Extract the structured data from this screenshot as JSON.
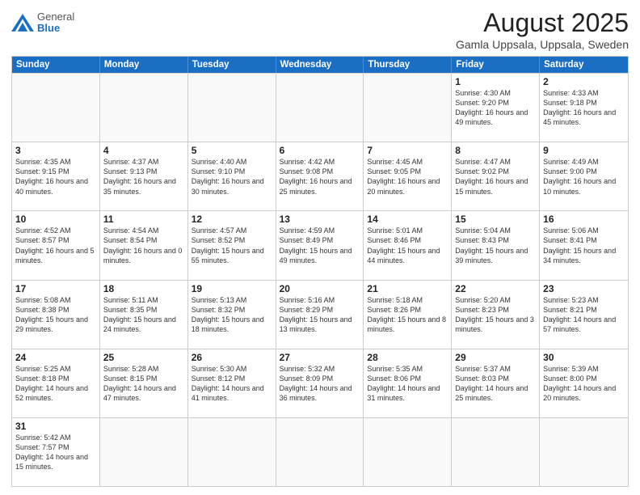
{
  "header": {
    "logo_general": "General",
    "logo_blue": "Blue",
    "title": "August 2025",
    "subtitle": "Gamla Uppsala, Uppsala, Sweden"
  },
  "weekdays": [
    "Sunday",
    "Monday",
    "Tuesday",
    "Wednesday",
    "Thursday",
    "Friday",
    "Saturday"
  ],
  "rows": [
    [
      {
        "day": "",
        "info": ""
      },
      {
        "day": "",
        "info": ""
      },
      {
        "day": "",
        "info": ""
      },
      {
        "day": "",
        "info": ""
      },
      {
        "day": "",
        "info": ""
      },
      {
        "day": "1",
        "info": "Sunrise: 4:30 AM\nSunset: 9:20 PM\nDaylight: 16 hours\nand 49 minutes."
      },
      {
        "day": "2",
        "info": "Sunrise: 4:33 AM\nSunset: 9:18 PM\nDaylight: 16 hours\nand 45 minutes."
      }
    ],
    [
      {
        "day": "3",
        "info": "Sunrise: 4:35 AM\nSunset: 9:15 PM\nDaylight: 16 hours\nand 40 minutes."
      },
      {
        "day": "4",
        "info": "Sunrise: 4:37 AM\nSunset: 9:13 PM\nDaylight: 16 hours\nand 35 minutes."
      },
      {
        "day": "5",
        "info": "Sunrise: 4:40 AM\nSunset: 9:10 PM\nDaylight: 16 hours\nand 30 minutes."
      },
      {
        "day": "6",
        "info": "Sunrise: 4:42 AM\nSunset: 9:08 PM\nDaylight: 16 hours\nand 25 minutes."
      },
      {
        "day": "7",
        "info": "Sunrise: 4:45 AM\nSunset: 9:05 PM\nDaylight: 16 hours\nand 20 minutes."
      },
      {
        "day": "8",
        "info": "Sunrise: 4:47 AM\nSunset: 9:02 PM\nDaylight: 16 hours\nand 15 minutes."
      },
      {
        "day": "9",
        "info": "Sunrise: 4:49 AM\nSunset: 9:00 PM\nDaylight: 16 hours\nand 10 minutes."
      }
    ],
    [
      {
        "day": "10",
        "info": "Sunrise: 4:52 AM\nSunset: 8:57 PM\nDaylight: 16 hours\nand 5 minutes."
      },
      {
        "day": "11",
        "info": "Sunrise: 4:54 AM\nSunset: 8:54 PM\nDaylight: 16 hours\nand 0 minutes."
      },
      {
        "day": "12",
        "info": "Sunrise: 4:57 AM\nSunset: 8:52 PM\nDaylight: 15 hours\nand 55 minutes."
      },
      {
        "day": "13",
        "info": "Sunrise: 4:59 AM\nSunset: 8:49 PM\nDaylight: 15 hours\nand 49 minutes."
      },
      {
        "day": "14",
        "info": "Sunrise: 5:01 AM\nSunset: 8:46 PM\nDaylight: 15 hours\nand 44 minutes."
      },
      {
        "day": "15",
        "info": "Sunrise: 5:04 AM\nSunset: 8:43 PM\nDaylight: 15 hours\nand 39 minutes."
      },
      {
        "day": "16",
        "info": "Sunrise: 5:06 AM\nSunset: 8:41 PM\nDaylight: 15 hours\nand 34 minutes."
      }
    ],
    [
      {
        "day": "17",
        "info": "Sunrise: 5:08 AM\nSunset: 8:38 PM\nDaylight: 15 hours\nand 29 minutes."
      },
      {
        "day": "18",
        "info": "Sunrise: 5:11 AM\nSunset: 8:35 PM\nDaylight: 15 hours\nand 24 minutes."
      },
      {
        "day": "19",
        "info": "Sunrise: 5:13 AM\nSunset: 8:32 PM\nDaylight: 15 hours\nand 18 minutes."
      },
      {
        "day": "20",
        "info": "Sunrise: 5:16 AM\nSunset: 8:29 PM\nDaylight: 15 hours\nand 13 minutes."
      },
      {
        "day": "21",
        "info": "Sunrise: 5:18 AM\nSunset: 8:26 PM\nDaylight: 15 hours\nand 8 minutes."
      },
      {
        "day": "22",
        "info": "Sunrise: 5:20 AM\nSunset: 8:23 PM\nDaylight: 15 hours\nand 3 minutes."
      },
      {
        "day": "23",
        "info": "Sunrise: 5:23 AM\nSunset: 8:21 PM\nDaylight: 14 hours\nand 57 minutes."
      }
    ],
    [
      {
        "day": "24",
        "info": "Sunrise: 5:25 AM\nSunset: 8:18 PM\nDaylight: 14 hours\nand 52 minutes."
      },
      {
        "day": "25",
        "info": "Sunrise: 5:28 AM\nSunset: 8:15 PM\nDaylight: 14 hours\nand 47 minutes."
      },
      {
        "day": "26",
        "info": "Sunrise: 5:30 AM\nSunset: 8:12 PM\nDaylight: 14 hours\nand 41 minutes."
      },
      {
        "day": "27",
        "info": "Sunrise: 5:32 AM\nSunset: 8:09 PM\nDaylight: 14 hours\nand 36 minutes."
      },
      {
        "day": "28",
        "info": "Sunrise: 5:35 AM\nSunset: 8:06 PM\nDaylight: 14 hours\nand 31 minutes."
      },
      {
        "day": "29",
        "info": "Sunrise: 5:37 AM\nSunset: 8:03 PM\nDaylight: 14 hours\nand 25 minutes."
      },
      {
        "day": "30",
        "info": "Sunrise: 5:39 AM\nSunset: 8:00 PM\nDaylight: 14 hours\nand 20 minutes."
      }
    ],
    [
      {
        "day": "31",
        "info": "Sunrise: 5:42 AM\nSunset: 7:57 PM\nDaylight: 14 hours\nand 15 minutes."
      },
      {
        "day": "",
        "info": ""
      },
      {
        "day": "",
        "info": ""
      },
      {
        "day": "",
        "info": ""
      },
      {
        "day": "",
        "info": ""
      },
      {
        "day": "",
        "info": ""
      },
      {
        "day": "",
        "info": ""
      }
    ]
  ]
}
